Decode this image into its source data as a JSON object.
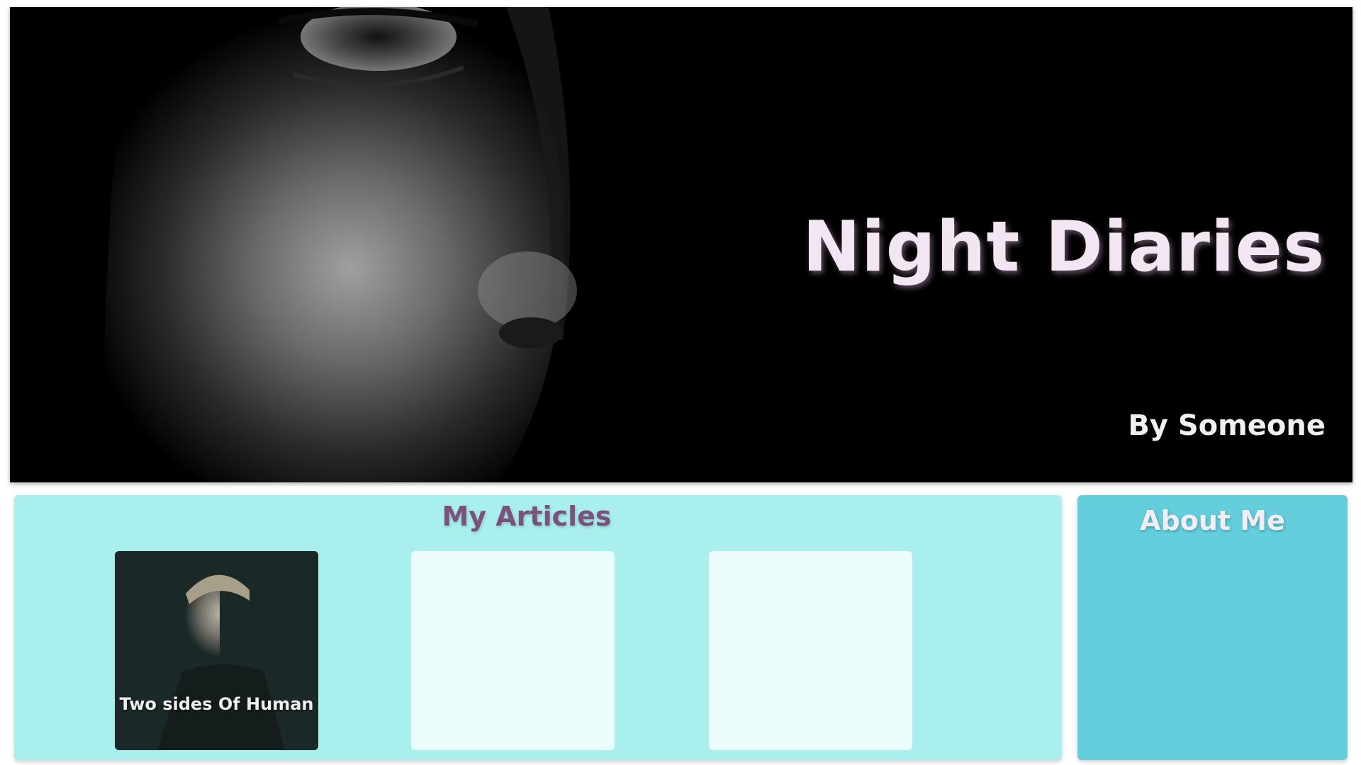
{
  "hero": {
    "title": "Night Diaries",
    "author": "By Someone"
  },
  "articles": {
    "heading": "My Articles",
    "cards": [
      {
        "caption": "Two sides Of Human",
        "has_image": true
      },
      {
        "caption": "",
        "has_image": false
      },
      {
        "caption": "",
        "has_image": false
      }
    ]
  },
  "about": {
    "heading": "About Me"
  },
  "colors": {
    "articles_bg": "#a9efee",
    "about_bg": "#64cedc",
    "articles_heading": "#7b527d",
    "title_text": "#f2e6f2",
    "empty_card": "#ebfcfc"
  }
}
